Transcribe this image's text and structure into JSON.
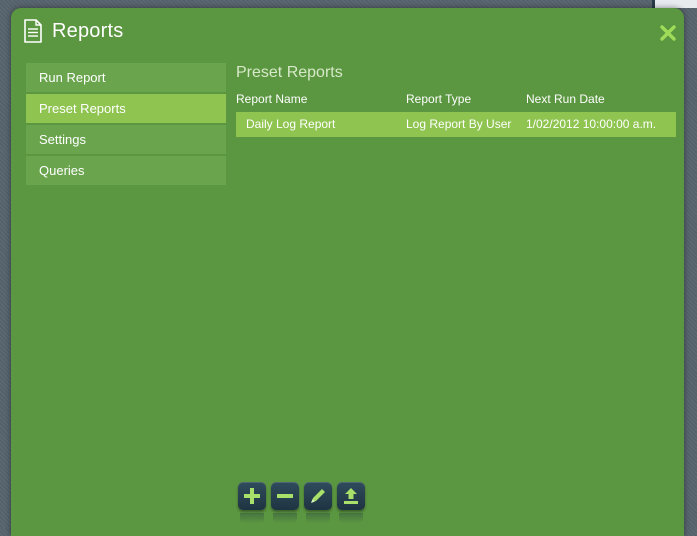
{
  "window": {
    "title": "Reports",
    "icon": "document-icon",
    "close_icon": "close-icon"
  },
  "sidebar": {
    "items": [
      {
        "label": "Run Report",
        "active": false
      },
      {
        "label": "Preset Reports",
        "active": true
      },
      {
        "label": "Settings",
        "active": false
      },
      {
        "label": "Queries",
        "active": false
      }
    ]
  },
  "main": {
    "section_title": "Preset Reports",
    "columns": [
      "Report Name",
      "Report Type",
      "Next Run Date"
    ],
    "rows": [
      {
        "name": "Daily Log Report",
        "type": "Log Report By User",
        "next_run": "1/02/2012 10:00:00 a.m."
      }
    ]
  },
  "toolbar": {
    "buttons": [
      {
        "name": "add-icon"
      },
      {
        "name": "remove-icon"
      },
      {
        "name": "edit-icon"
      },
      {
        "name": "upload-icon"
      }
    ]
  },
  "colors": {
    "window_bg": "#5b9640",
    "item_bg": "#6aa54e",
    "active_bg": "#8ec44f",
    "close": "#9fdc5a",
    "button_bg": "#26404f"
  }
}
